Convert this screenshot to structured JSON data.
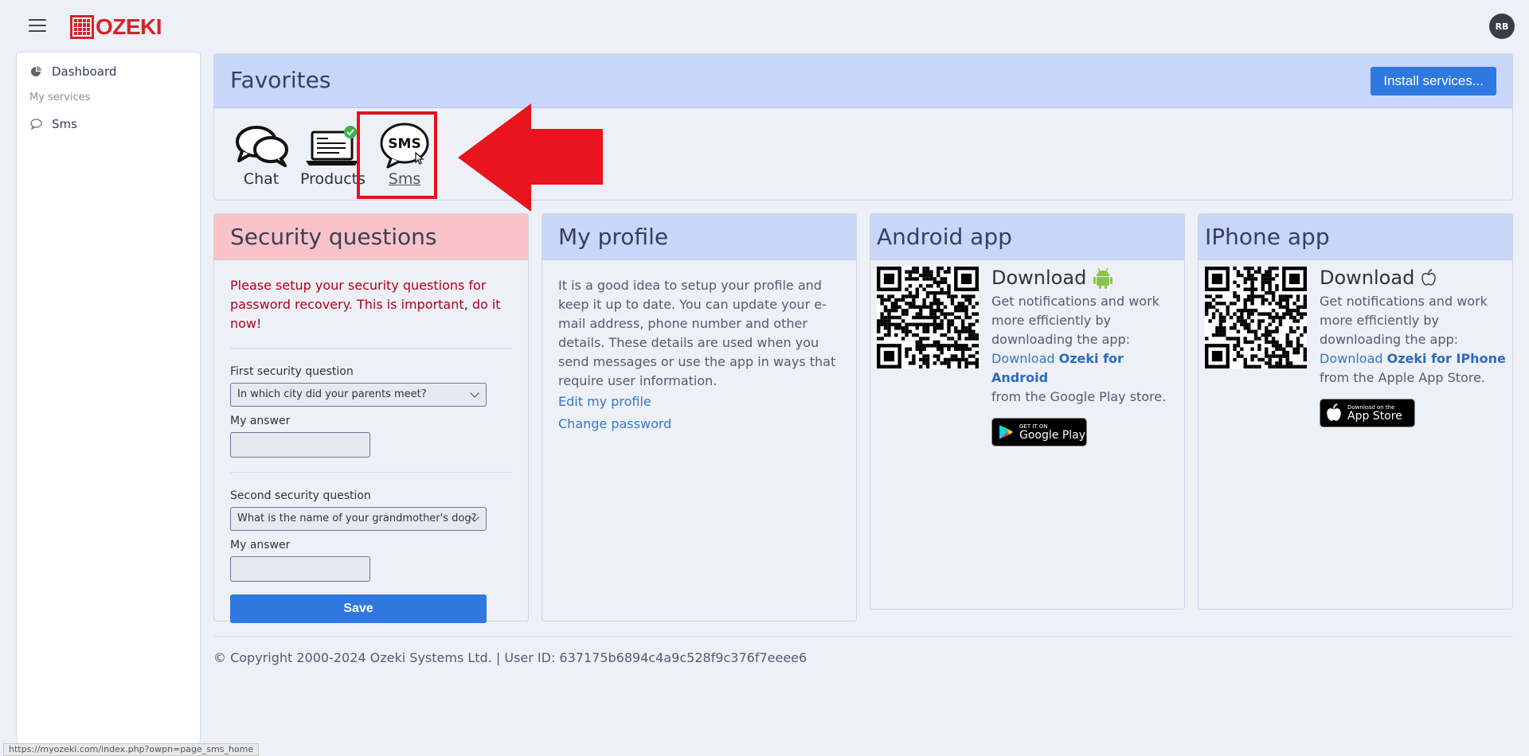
{
  "app": {
    "logo": "OZEKI",
    "user_initials": "RB"
  },
  "sidebar": {
    "items": [
      {
        "label": "Dashboard"
      },
      {
        "label": "Sms"
      }
    ],
    "section": "My services"
  },
  "favorites": {
    "title": "Favorites",
    "install_label": "Install services...",
    "icons": [
      {
        "label": "Chat"
      },
      {
        "label": "Products"
      },
      {
        "label": "Sms",
        "glyph": "SMS"
      }
    ]
  },
  "security": {
    "title": "Security questions",
    "warning": "Please setup your security questions for password recovery. This is important, do it now!",
    "q1_label": "First security question",
    "q1_value": "In which city did your parents meet?",
    "answer_label": "My answer",
    "q2_label": "Second security question",
    "q2_value": "What is the name of your grandmother's dog?",
    "save_label": "Save"
  },
  "profile": {
    "title": "My profile",
    "text": "It is a good idea to setup your profile and keep it up to date. You can update your e-mail address, phone number and other details. These details are used when you send messages or use the app in ways that require user information.",
    "edit_link": "Edit my profile",
    "password_link": "Change password"
  },
  "android": {
    "title": "Android app",
    "download": "Download",
    "text1": "Get notifications and work more efficiently by downloading the app:",
    "link_prefix": "Download",
    "link_name": "Ozeki for Android",
    "text2": "from the Google Play store.",
    "badge_small": "GET IT ON",
    "badge_big": "Google Play"
  },
  "iphone": {
    "title": "IPhone app",
    "download": "Download",
    "text1": "Get notifications and work more efficiently by downloading the app:",
    "link_prefix": "Download",
    "link_name": "Ozeki for IPhone",
    "text2": "from the Apple App Store.",
    "badge_small": "Download on the",
    "badge_big": "App Store"
  },
  "footer": {
    "text": "© Copyright 2000-2024 Ozeki Systems Ltd. | User ID: 637175b6894c4a9c528f9c376f7eeee6"
  },
  "status_url": "https://myozeki.com/index.php?owpn=page_sms_home",
  "colors": {
    "brand_red": "#d8222a",
    "accent_blue": "#2f78e0",
    "warning_red": "#b00018",
    "pink_header": "#f9c3c9",
    "blue_header": "#c8d6fa"
  }
}
